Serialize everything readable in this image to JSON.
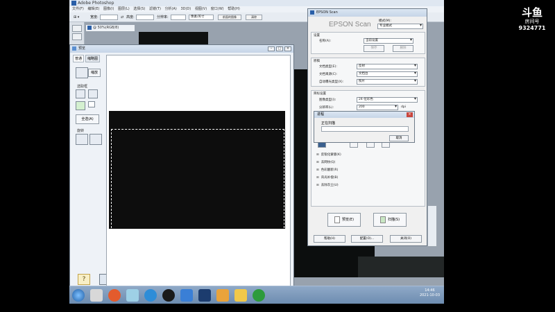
{
  "photoshop": {
    "window_title": "Adobe Photoshop",
    "menu": [
      "文件(F)",
      "编辑(E)",
      "图像(I)",
      "图层(L)",
      "选择(S)",
      "滤镜(T)",
      "分析(A)",
      "3D(D)",
      "视图(V)",
      "窗口(W)",
      "帮助(H)"
    ],
    "options": {
      "width_label": "宽度:",
      "height_label": "高度:",
      "resolution_label": "分辨率:",
      "unit": "像素/英寸",
      "front_image": "前面的图像",
      "clear": "清除"
    },
    "doc_tab": "@ 50%(RGB/8)"
  },
  "preview": {
    "title": "预览",
    "tabs": [
      "普通",
      "缩略图"
    ],
    "zoom_button": "缩放",
    "marquee_label": "选取框",
    "all_button": "全选(A)",
    "rotate_label": "旋转"
  },
  "epson": {
    "title": "EPSON Scan",
    "logo": "EPSON Scan",
    "mode_label": "模式(M):",
    "mode_value": "专业模式",
    "settings_section": "设置",
    "name_label": "名称(A):",
    "name_value": "当前设置",
    "save_button": "保存",
    "delete_button": "删除",
    "original_section": "原稿",
    "doc_type_label": "文档类型(E):",
    "doc_type_value": "反射",
    "doc_source_label": "文档来源(C):",
    "doc_source_value": "文档台",
    "auto_exposure_label": "自动曝光类型(X):",
    "auto_exposure_value": "照片",
    "target_section": "目标设置",
    "image_type_label": "图像类型(I):",
    "image_type_value": "24-位彩色",
    "resolution_label": "分辨率(L):",
    "resolution_value": "200",
    "resolution_unit": "dpi",
    "options": [
      "反锐化蒙版(K)",
      "去网纹(Q)",
      "色彩翻新(R)",
      "背光补偿(B)",
      "去除灰尘(U)"
    ],
    "preview_button": "预览(E)",
    "scan_button": "扫描(S)",
    "help_button": "帮助(H)",
    "config_button": "配置(O)...",
    "close_button": "关闭(O)"
  },
  "progress": {
    "title": "进程",
    "status": "正在扫描",
    "progress": 0,
    "cancel": "取消"
  },
  "taskbar": {
    "time": "14:46",
    "date": "2021-10-03"
  },
  "watermark": {
    "logo": "斗鱼",
    "label": "房间号",
    "room_id": "9324771"
  }
}
